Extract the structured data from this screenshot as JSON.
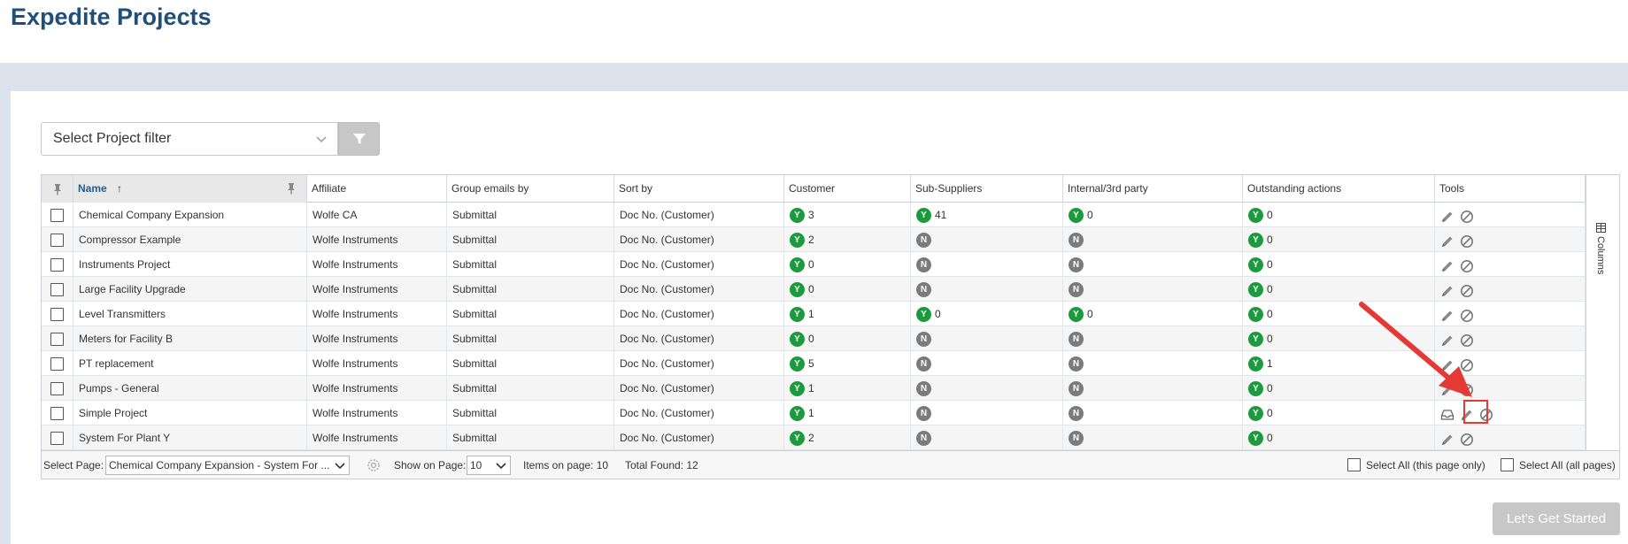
{
  "page": {
    "title": "Expedite Projects"
  },
  "filter": {
    "placeholder": "Select Project filter"
  },
  "grid": {
    "headers": [
      "Name",
      "Affiliate",
      "Group emails by",
      "Sort by",
      "Customer",
      "Sub-Suppliers",
      "Internal/3rd party",
      "Outstanding actions",
      "Tools"
    ],
    "sort_indicator": "↑",
    "rows": [
      {
        "name": "Chemical Company Expansion",
        "affiliate": "Wolfe CA",
        "group": "Submittal",
        "sort": "Doc No. (Customer)",
        "customer": {
          "flag": "Y",
          "count": "3"
        },
        "sub": {
          "flag": "Y",
          "count": "41"
        },
        "internal": {
          "flag": "Y",
          "count": "0"
        },
        "outstanding": {
          "flag": "Y",
          "count": "0"
        }
      },
      {
        "name": "Compressor Example",
        "affiliate": "Wolfe Instruments",
        "group": "Submittal",
        "sort": "Doc No. (Customer)",
        "customer": {
          "flag": "Y",
          "count": "2"
        },
        "sub": {
          "flag": "N",
          "count": ""
        },
        "internal": {
          "flag": "N",
          "count": ""
        },
        "outstanding": {
          "flag": "Y",
          "count": "0"
        }
      },
      {
        "name": "Instruments Project",
        "affiliate": "Wolfe Instruments",
        "group": "Submittal",
        "sort": "Doc No. (Customer)",
        "customer": {
          "flag": "Y",
          "count": "0"
        },
        "sub": {
          "flag": "N",
          "count": ""
        },
        "internal": {
          "flag": "N",
          "count": ""
        },
        "outstanding": {
          "flag": "Y",
          "count": "0"
        }
      },
      {
        "name": "Large Facility Upgrade",
        "affiliate": "Wolfe Instruments",
        "group": "Submittal",
        "sort": "Doc No. (Customer)",
        "customer": {
          "flag": "Y",
          "count": "0"
        },
        "sub": {
          "flag": "N",
          "count": ""
        },
        "internal": {
          "flag": "N",
          "count": ""
        },
        "outstanding": {
          "flag": "Y",
          "count": "0"
        }
      },
      {
        "name": "Level Transmitters",
        "affiliate": "Wolfe Instruments",
        "group": "Submittal",
        "sort": "Doc No. (Customer)",
        "customer": {
          "flag": "Y",
          "count": "1"
        },
        "sub": {
          "flag": "Y",
          "count": "0"
        },
        "internal": {
          "flag": "Y",
          "count": "0"
        },
        "outstanding": {
          "flag": "Y",
          "count": "0"
        }
      },
      {
        "name": "Meters for Facility B",
        "affiliate": "Wolfe Instruments",
        "group": "Submittal",
        "sort": "Doc No. (Customer)",
        "customer": {
          "flag": "Y",
          "count": "0"
        },
        "sub": {
          "flag": "N",
          "count": ""
        },
        "internal": {
          "flag": "N",
          "count": ""
        },
        "outstanding": {
          "flag": "Y",
          "count": "0"
        }
      },
      {
        "name": "PT replacement",
        "affiliate": "Wolfe Instruments",
        "group": "Submittal",
        "sort": "Doc No. (Customer)",
        "customer": {
          "flag": "Y",
          "count": "5"
        },
        "sub": {
          "flag": "N",
          "count": ""
        },
        "internal": {
          "flag": "N",
          "count": ""
        },
        "outstanding": {
          "flag": "Y",
          "count": "1"
        }
      },
      {
        "name": "Pumps - General",
        "affiliate": "Wolfe Instruments",
        "group": "Submittal",
        "sort": "Doc No. (Customer)",
        "customer": {
          "flag": "Y",
          "count": "1"
        },
        "sub": {
          "flag": "N",
          "count": ""
        },
        "internal": {
          "flag": "N",
          "count": ""
        },
        "outstanding": {
          "flag": "Y",
          "count": "0"
        }
      },
      {
        "name": "Simple Project",
        "affiliate": "Wolfe Instruments",
        "group": "Submittal",
        "sort": "Doc No. (Customer)",
        "customer": {
          "flag": "Y",
          "count": "1"
        },
        "sub": {
          "flag": "N",
          "count": ""
        },
        "internal": {
          "flag": "N",
          "count": ""
        },
        "outstanding": {
          "flag": "Y",
          "count": "0"
        },
        "has_inbox": true
      },
      {
        "name": "System For Plant Y",
        "affiliate": "Wolfe Instruments",
        "group": "Submittal",
        "sort": "Doc No. (Customer)",
        "customer": {
          "flag": "Y",
          "count": "2"
        },
        "sub": {
          "flag": "N",
          "count": ""
        },
        "internal": {
          "flag": "N",
          "count": ""
        },
        "outstanding": {
          "flag": "Y",
          "count": "0"
        }
      }
    ],
    "columns_tab_label": "Columns"
  },
  "footer": {
    "select_page_label": "Select Page:",
    "select_page_value": "Chemical Company Expansion - System For ...",
    "show_on_page_label": "Show on Page:",
    "show_on_page_value": "10",
    "items_on_page": "Items on page: 10",
    "total_found": "Total Found: 12",
    "select_all_page": "Select All (this page only)",
    "select_all_pages": "Select All (all pages)"
  },
  "cta": {
    "label": "Let's Get Started"
  },
  "colors": {
    "title": "#1f4e79",
    "yes_badge": "#1e9a3e",
    "no_badge": "#7b7b7b",
    "highlight": "#e53935"
  }
}
